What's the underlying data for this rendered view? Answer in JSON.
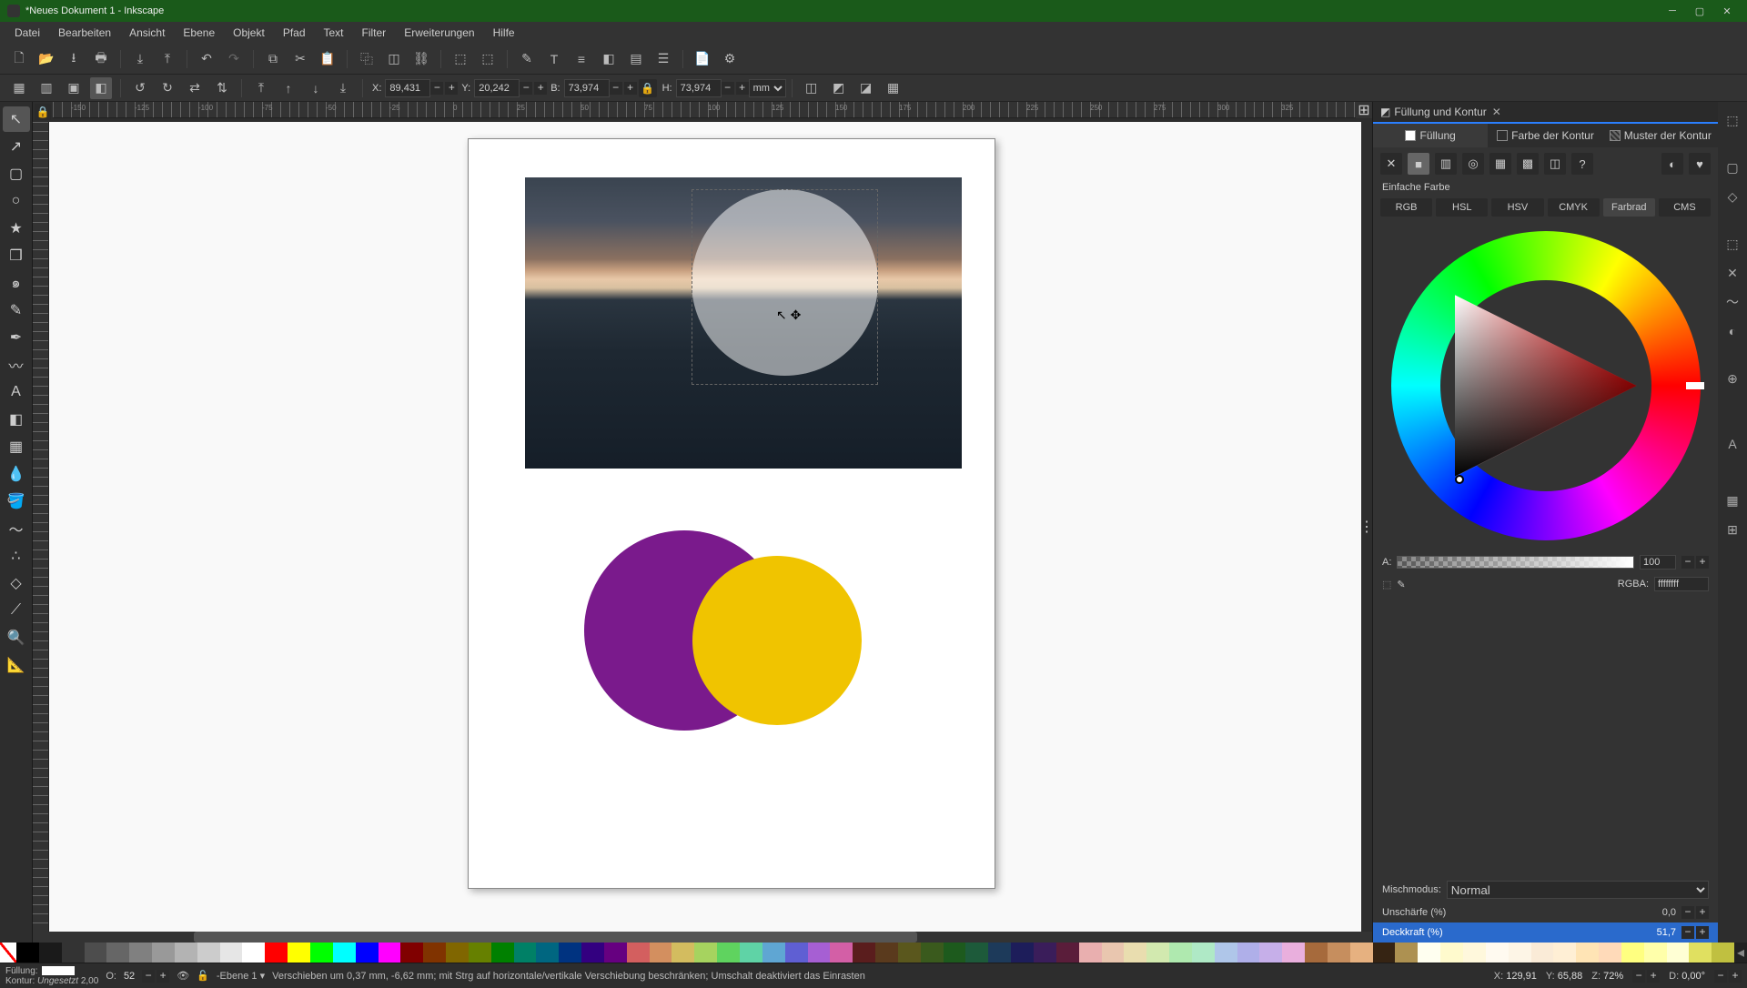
{
  "title": "*Neues Dokument 1 - Inkscape",
  "menu": [
    "Datei",
    "Bearbeiten",
    "Ansicht",
    "Ebene",
    "Objekt",
    "Pfad",
    "Text",
    "Filter",
    "Erweiterungen",
    "Hilfe"
  ],
  "toolbar2": {
    "x_label": "X:",
    "x": "89,431",
    "y_label": "Y:",
    "y": "20,242",
    "w_label": "B:",
    "w": "73,974",
    "h_label": "H:",
    "h": "73,974",
    "unit": "mm"
  },
  "ruler_h_ticks": [
    "-150",
    "-125",
    "-100",
    "-75",
    "-50",
    "-25",
    "0",
    "25",
    "50",
    "75",
    "100",
    "125",
    "150",
    "175",
    "200",
    "225",
    "250",
    "275",
    "300",
    "325"
  ],
  "right_panel": {
    "title": "Füllung und Kontur",
    "tabs": {
      "fill": "Füllung",
      "stroke_paint": "Farbe der Kontur",
      "stroke_style": "Muster der Kontur"
    },
    "flat_label": "Einfache Farbe",
    "modes": [
      "RGB",
      "HSL",
      "HSV",
      "CMYK",
      "Farbrad",
      "CMS"
    ],
    "alpha_label": "A:",
    "alpha_value": "100",
    "rgba_label": "RGBA:",
    "rgba_value": "ffffffff",
    "blend_label": "Mischmodus:",
    "blend_value": "Normal",
    "blur_label": "Unschärfe (%)",
    "blur_value": "0,0",
    "opacity_label": "Deckkraft (%)",
    "opacity_value": "51,7"
  },
  "statusbar": {
    "fill_label": "Füllung:",
    "stroke_label": "Kontur:",
    "stroke_value": "Ungesetzt",
    "stroke_width": "2,00",
    "opacity_label": "O:",
    "opacity_value": "52",
    "layer": "-Ebene 1",
    "message": "Verschieben um 0,37 mm, -6,62 mm; mit Strg auf horizontale/vertikale Verschiebung beschränken; Umschalt deaktiviert das Einrasten",
    "x_label": "X:",
    "x_value": "129,91",
    "y_label": "Y:",
    "y_value": "65,88",
    "z_label": "Z:",
    "z_value": "72%",
    "d_label": "D:",
    "d_value": "0,00°"
  },
  "palette_colors": [
    "#000000",
    "#1a1a1a",
    "#333333",
    "#4d4d4d",
    "#666666",
    "#808080",
    "#999999",
    "#b3b3b3",
    "#cccccc",
    "#e6e6e6",
    "#ffffff",
    "#ff0000",
    "#ffff00",
    "#00ff00",
    "#00ffff",
    "#0000ff",
    "#ff00ff",
    "#800000",
    "#803300",
    "#806600",
    "#668000",
    "#008000",
    "#008066",
    "#006680",
    "#003380",
    "#330080",
    "#660080",
    "#d35f5f",
    "#d38f5f",
    "#d3bc5f",
    "#a6d35f",
    "#5fd35f",
    "#5fd3a6",
    "#5fa6d3",
    "#5f5fd3",
    "#a65fd3",
    "#d35fa6",
    "#5a1d1d",
    "#5a3a1d",
    "#5a571d",
    "#3a5a1d",
    "#1d5a1d",
    "#1d5a3a",
    "#1d3a5a",
    "#1d1d5a",
    "#3a1d5a",
    "#5a1d3a",
    "#e9afaf",
    "#e9c6af",
    "#e9ddaf",
    "#d2e9af",
    "#afe9af",
    "#afe9c6",
    "#afc6e9",
    "#afafe9",
    "#c6afe9",
    "#e9afdd",
    "#a66a3c",
    "#c68e5e",
    "#e6b180",
    "#362413",
    "#ad9151",
    "#fffff0",
    "#fffacd",
    "#fff8dc",
    "#fffaf0",
    "#fdf5e6",
    "#faebd7",
    "#ffefd5",
    "#ffe4b5",
    "#ffdab9",
    "#ffff80",
    "#ffffaa",
    "#ffffd4",
    "#e0e060",
    "#c0c040"
  ],
  "chart_data": null
}
